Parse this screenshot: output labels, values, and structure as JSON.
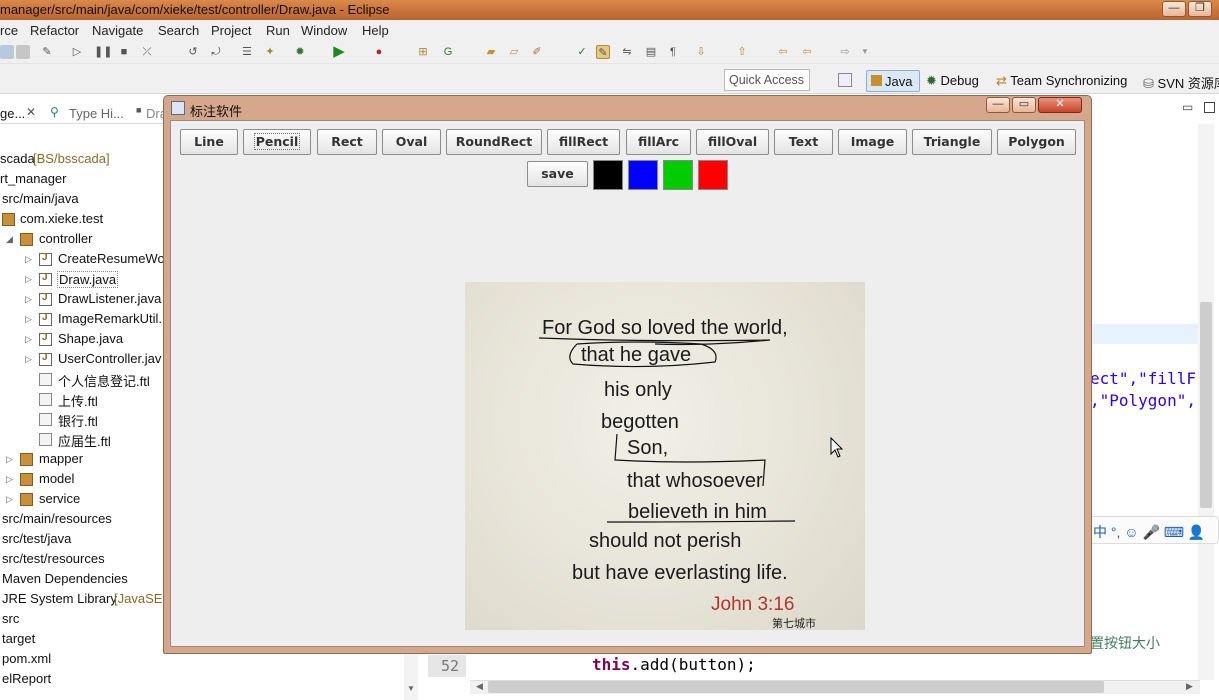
{
  "window": {
    "title": "manager/src/main/java/com/xieke/test/controller/Draw.java - Eclipse",
    "buttons": [
      "minimize",
      "restore"
    ]
  },
  "menubar": [
    "rce",
    "Refactor",
    "Navigate",
    "Search",
    "Project",
    "Run",
    "Window",
    "Help"
  ],
  "quick_access": {
    "placeholder": "Quick Access"
  },
  "perspectives": [
    {
      "label": "Java",
      "icon": "java-perspective-icon",
      "active": true
    },
    {
      "label": "Debug",
      "icon": "bug-icon"
    },
    {
      "label": "Team Synchronizing",
      "icon": "sync-icon"
    },
    {
      "label": "SVN 资源库",
      "icon": "svn-icon"
    }
  ],
  "left_tabs": [
    "ge...",
    "Type Hi...",
    "Dra"
  ],
  "tree": [
    {
      "label": "scada",
      "decoration": "[BS/bsscada]"
    },
    {
      "label": "rt_manager"
    },
    {
      "label": "src/main/java"
    },
    {
      "label": "com.xieke.test"
    },
    {
      "label": "controller"
    },
    {
      "label": "CreateResumeWo"
    },
    {
      "label": "Draw.java"
    },
    {
      "label": "DrawListener.java"
    },
    {
      "label": "ImageRemarkUtil."
    },
    {
      "label": "Shape.java"
    },
    {
      "label": "UserController.jav"
    },
    {
      "label": "个人信息登记.ftl"
    },
    {
      "label": "上传.ftl"
    },
    {
      "label": "银行.ftl"
    },
    {
      "label": "应届生.ftl"
    },
    {
      "label": "mapper"
    },
    {
      "label": "model"
    },
    {
      "label": "service"
    },
    {
      "label": "src/main/resources"
    },
    {
      "label": "src/test/java"
    },
    {
      "label": "src/test/resources"
    },
    {
      "label": "Maven Dependencies"
    },
    {
      "label": "JRE System Library",
      "decoration": "[JavaSE-"
    },
    {
      "label": "src"
    },
    {
      "label": "target"
    },
    {
      "label": "pom.xml"
    },
    {
      "label": "elReport"
    }
  ],
  "editor": {
    "code_fragment_1": "ect\",\"fillF",
    "code_fragment_2": ",\"Polygon\",",
    "comment_fragment": "置按钮大小",
    "line_number": "52",
    "line_code": "this.add(button);"
  },
  "ime": {
    "logo": "S",
    "text": "中 °, ☺ 🎤 ⌨ 👤"
  },
  "dialog": {
    "title": "标注软件",
    "tools": [
      "Line",
      "Pencil",
      "Rect",
      "Oval",
      "RoundRect",
      "fillRect",
      "fillArc",
      "fillOval",
      "Text",
      "Image",
      "Triangle",
      "Polygon"
    ],
    "selected_tool": "Pencil",
    "save_label": "save",
    "colors": [
      "#000000",
      "#0000ff",
      "#00cc00",
      "#ff0000"
    ],
    "image_text": {
      "lines": [
        "For God so loved the world,",
        "that he gave",
        "his only",
        "begotten",
        "Son,",
        "that whosoever",
        "believeth in him",
        "should not perish",
        "but have everlasting life."
      ],
      "reference": "John 3:16",
      "watermark": "第七城市"
    }
  }
}
